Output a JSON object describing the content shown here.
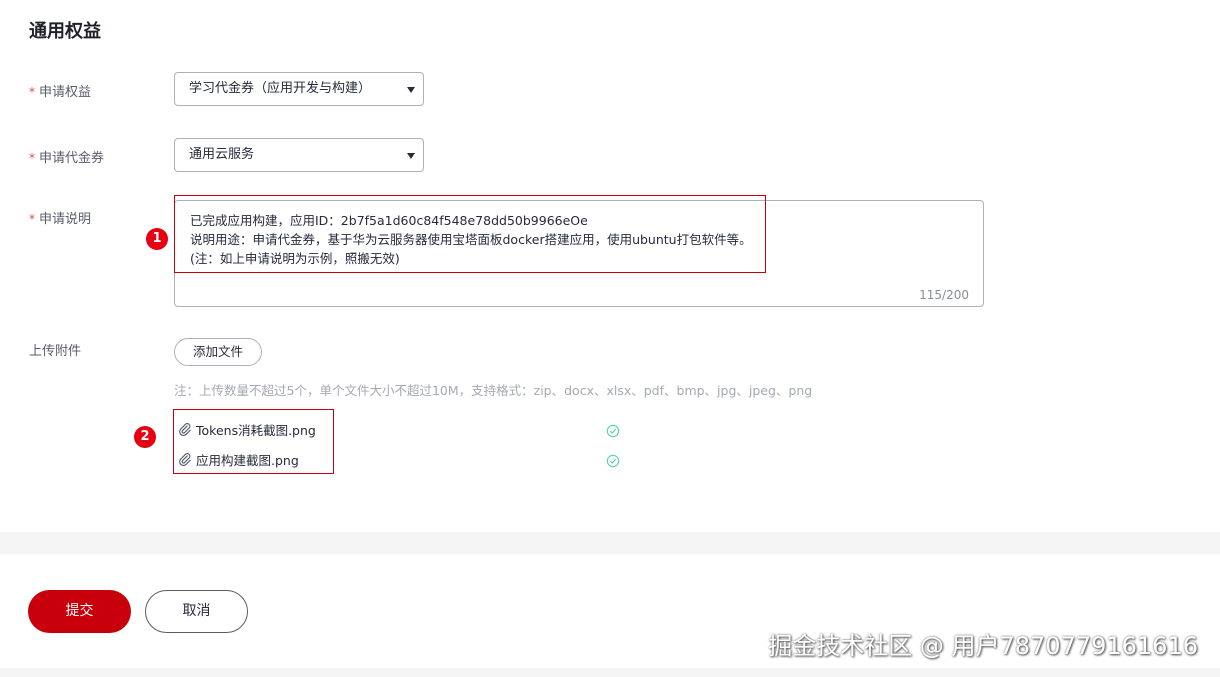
{
  "section_title": "通用权益",
  "form": {
    "required_mark": "*",
    "benefit": {
      "label": "申请权益",
      "value": "学习代金券（应用开发与构建）"
    },
    "voucher": {
      "label": "申请代金券",
      "value": "通用云服务"
    },
    "description": {
      "label": "申请说明",
      "lines": [
        "已完成应用构建，应用ID：2b7f5a1d60c84f548e78dd50b9966eOe",
        "说明用途：申请代金券，基于华为云服务器使用宝塔面板docker搭建应用，使用ubuntu打包软件等。",
        "(注：如上申请说明为示例，照搬无效)"
      ],
      "counter": "115/200"
    },
    "attachment": {
      "label": "上传附件",
      "add_button": "添加文件",
      "hint": "注：上传数量不超过5个，单个文件大小不超过10M，支持格式：zip、docx、xlsx、pdf、bmp、jpg、jpeg、png",
      "files": [
        "Tokens消耗截图.png",
        "应用构建截图.png"
      ]
    }
  },
  "annotations": {
    "badge1": "1",
    "badge2": "2"
  },
  "actions": {
    "submit": "提交",
    "cancel": "取消"
  },
  "watermark": "掘金技术社区 @ 用户7870779161616",
  "colors": {
    "primary": "#c7000b",
    "required": "#e34d59",
    "success": "#50d4ab"
  }
}
